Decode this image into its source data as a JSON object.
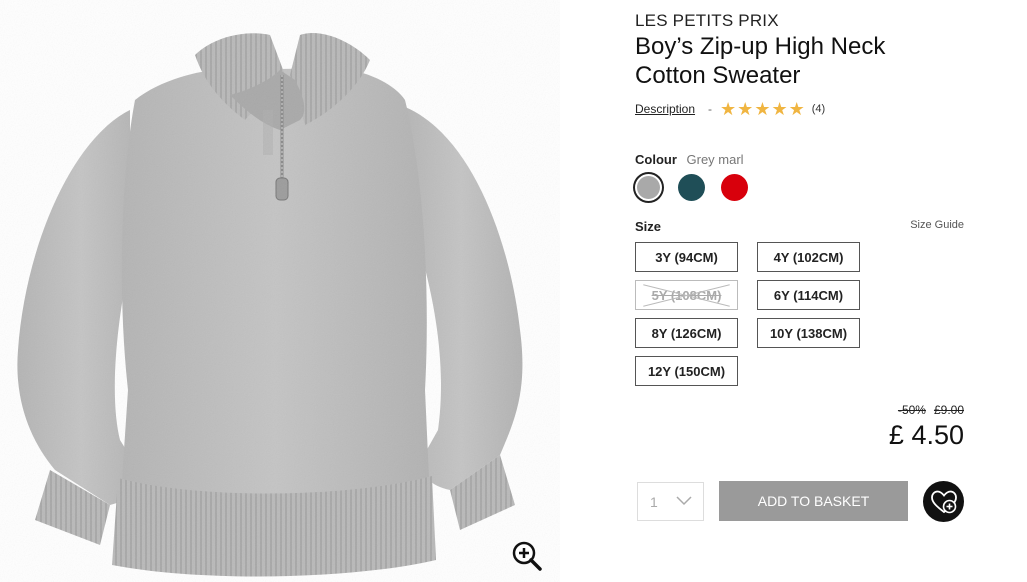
{
  "product": {
    "brand": "LES PETITS PRIX",
    "title": "Boy’s Zip-up High Neck Cotton Sweater",
    "description_link": "Description",
    "separator": "-",
    "rating": {
      "stars": 5,
      "max_stars": 5,
      "review_count": "(4)"
    }
  },
  "colour": {
    "label": "Colour",
    "selected_value": "Grey marl",
    "swatches": [
      {
        "name": "grey",
        "color": "#a9a9a9",
        "selected": true
      },
      {
        "name": "teal",
        "color": "#1f4e57",
        "selected": false
      },
      {
        "name": "red",
        "color": "#d8000c",
        "selected": false
      }
    ]
  },
  "size": {
    "label": "Size",
    "guide_link": "Size Guide",
    "options": [
      {
        "label": "3Y (94CM)",
        "available": true
      },
      {
        "label": "4Y (102CM)",
        "available": true
      },
      {
        "label": "5Y (108CM)",
        "available": false
      },
      {
        "label": "6Y (114CM)",
        "available": true
      },
      {
        "label": "8Y (126CM)",
        "available": true
      },
      {
        "label": "10Y (138CM)",
        "available": true
      },
      {
        "label": "12Y (150CM)",
        "available": true
      }
    ]
  },
  "pricing": {
    "discount": "-50%",
    "old_price": "£9.00",
    "price": "£ 4.50"
  },
  "purchase": {
    "quantity": "1",
    "add_to_basket": "ADD TO BASKET"
  },
  "icons": {
    "zoom": "zoom-in-icon",
    "wishlist": "heart-plus-icon",
    "quantity_dropdown": "chevron-down-icon",
    "rating": "star-icon"
  },
  "colors": {
    "star": "#f0b541",
    "add_button_bg": "#9a9a9a",
    "wishlist_bg": "#111111"
  }
}
